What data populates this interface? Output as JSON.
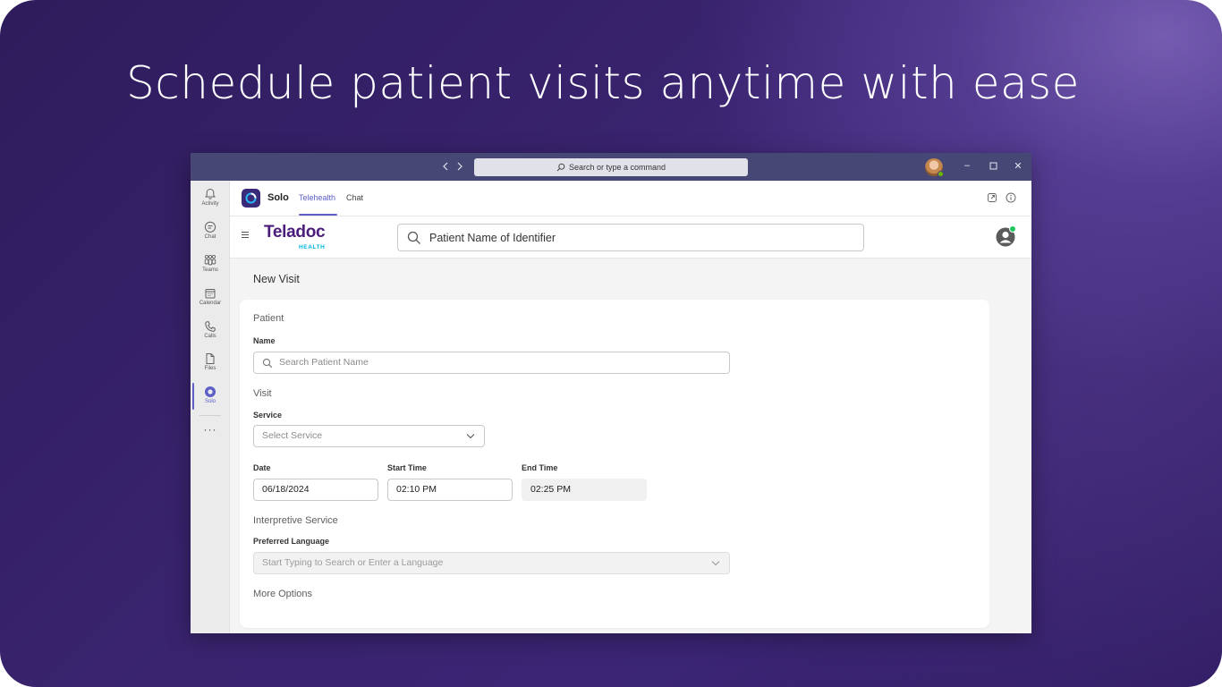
{
  "headline": "Schedule patient visits anytime with ease",
  "titlebar": {
    "command_placeholder": "Search or type a command"
  },
  "rail": {
    "items": [
      {
        "label": "Activity",
        "icon": "bell-icon"
      },
      {
        "label": "Chat",
        "icon": "chat-icon"
      },
      {
        "label": "Teams",
        "icon": "teams-icon"
      },
      {
        "label": "Calendar",
        "icon": "calendar-icon"
      },
      {
        "label": "Calls",
        "icon": "phone-icon"
      },
      {
        "label": "Files",
        "icon": "file-icon"
      },
      {
        "label": "Solo",
        "icon": "solo-icon",
        "active": true
      }
    ],
    "more": "···"
  },
  "app_header": {
    "app_name": "Solo",
    "tabs": [
      {
        "label": "Telehealth",
        "active": true
      },
      {
        "label": "Chat",
        "active": false
      }
    ]
  },
  "teladoc": {
    "logo_word": "Teladoc",
    "logo_sub": "HEALTH",
    "search_text": "Patient Name of Identifier"
  },
  "page": {
    "title": "New Visit",
    "patient_section": "Patient",
    "name_label": "Name",
    "name_placeholder": "Search Patient Name",
    "visit_section": "Visit",
    "service_label": "Service",
    "service_placeholder": "Select Service",
    "date_label": "Date",
    "date_value": "06/18/2024",
    "start_label": "Start Time",
    "start_value": "02:10 PM",
    "end_label": "End Time",
    "end_value": "02:25 PM",
    "interp_section": "Interpretive Service",
    "lang_label": "Preferred Language",
    "lang_placeholder": "Start Typing to Search or Enter a Language",
    "more_options": "More Options"
  },
  "colors": {
    "brand_purple": "#4b1c7a",
    "teams_accent": "#5b5fc7",
    "titlebar": "#464775",
    "health_cyan": "#00b5e2"
  }
}
